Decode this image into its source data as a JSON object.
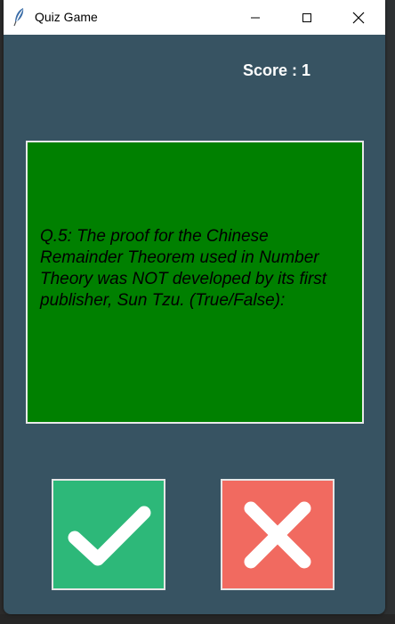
{
  "window": {
    "title": "Quiz Game",
    "controls": {
      "minimize": "minimize-icon",
      "maximize": "maximize-icon",
      "close": "close-icon"
    }
  },
  "score": {
    "label": "Score : 1"
  },
  "question": {
    "text": "Q.5: The proof for the Chinese Remainder Theorem used in Number Theory was NOT developed by its first publisher, Sun Tzu. (True/False):"
  },
  "answers": {
    "true_icon": "checkmark-icon",
    "false_icon": "x-icon"
  },
  "colors": {
    "window_bg": "#375362",
    "card_bg": "#008000",
    "true_button": "#2db879",
    "false_button": "#f16a60",
    "score_text": "#ffffff"
  }
}
